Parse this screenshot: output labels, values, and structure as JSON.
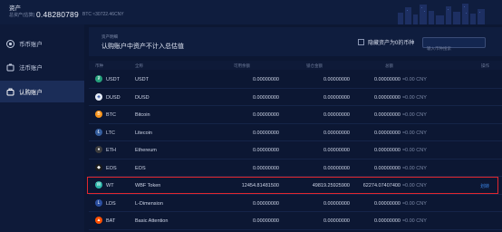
{
  "header": {
    "title": "资产",
    "total_label": "总资产(估算)",
    "total_value": "0.48280789",
    "total_sub": "BTC ≈30722.46CNY"
  },
  "sidebar": {
    "items": [
      {
        "label": "币币账户",
        "icon": "coins-icon"
      },
      {
        "label": "法币账户",
        "icon": "fiat-icon"
      },
      {
        "label": "认购账户",
        "icon": "subscription-icon"
      }
    ],
    "active_index": 2
  },
  "main": {
    "small_title": "资产明细",
    "title": "认购账户中资产不计入总估值",
    "hide_zero_label": "隐藏资产为0的币种",
    "search_placeholder": "输入币种搜索"
  },
  "table": {
    "columns": [
      "币种",
      "全称",
      "可用余额",
      "锁仓金额",
      "总额",
      "操作"
    ],
    "rows": [
      {
        "symbol": "USDT",
        "name": "USDT",
        "available": "0.00000000",
        "locked": "0.00000000",
        "total": "0.00000000",
        "cny": "≈0.00 CNY",
        "action": "",
        "color": "#26a17b",
        "glyph": "₮"
      },
      {
        "symbol": "DUSD",
        "name": "DUSD",
        "available": "0.00000000",
        "locked": "0.00000000",
        "total": "0.00000000",
        "cny": "≈0.00 CNY",
        "action": "",
        "color": "#e8eef8",
        "glyph": "◈"
      },
      {
        "symbol": "BTC",
        "name": "Bitcoin",
        "available": "0.00000000",
        "locked": "0.00000000",
        "total": "0.00000000",
        "cny": "≈0.00 CNY",
        "action": "",
        "color": "#f7931a",
        "glyph": "B"
      },
      {
        "symbol": "LTC",
        "name": "Litecoin",
        "available": "0.00000000",
        "locked": "0.00000000",
        "total": "0.00000000",
        "cny": "≈0.00 CNY",
        "action": "",
        "color": "#345d9d",
        "glyph": "Ł"
      },
      {
        "symbol": "ETH",
        "name": "Ethereum",
        "available": "0.00000000",
        "locked": "0.00000000",
        "total": "0.00000000",
        "cny": "≈0.00 CNY",
        "action": "",
        "color": "#3c3c3d",
        "glyph": "♦"
      },
      {
        "symbol": "EOS",
        "name": "EOS",
        "available": "0.00000000",
        "locked": "0.00000000",
        "total": "0.00000000",
        "cny": "≈0.00 CNY",
        "action": "",
        "color": "#1c1c1c",
        "glyph": "◆"
      },
      {
        "symbol": "WT",
        "name": "WBF Token",
        "available": "12454.81481500",
        "locked": "49819.25925900",
        "total": "62274.07407400",
        "cny": "≈0.00 CNY",
        "action": "划转",
        "color": "#2bb5a8",
        "glyph": "W"
      },
      {
        "symbol": "LDS",
        "name": "L-Dimension",
        "available": "0.00000000",
        "locked": "0.00000000",
        "total": "0.00000000",
        "cny": "≈0.00 CNY",
        "action": "",
        "color": "#2a4ea0",
        "glyph": "L"
      },
      {
        "symbol": "BAT",
        "name": "Basic Attention",
        "available": "0.00000000",
        "locked": "0.00000000",
        "total": "0.00000000",
        "cny": "≈0.00 CNY",
        "action": "",
        "color": "#ff5000",
        "glyph": "▲"
      }
    ],
    "highlighted_index": 6
  },
  "colors": {
    "background": "#0c1733",
    "panel": "#0f1d3e",
    "accent_link": "#3b86e8",
    "highlight_border": "#e0262e"
  }
}
